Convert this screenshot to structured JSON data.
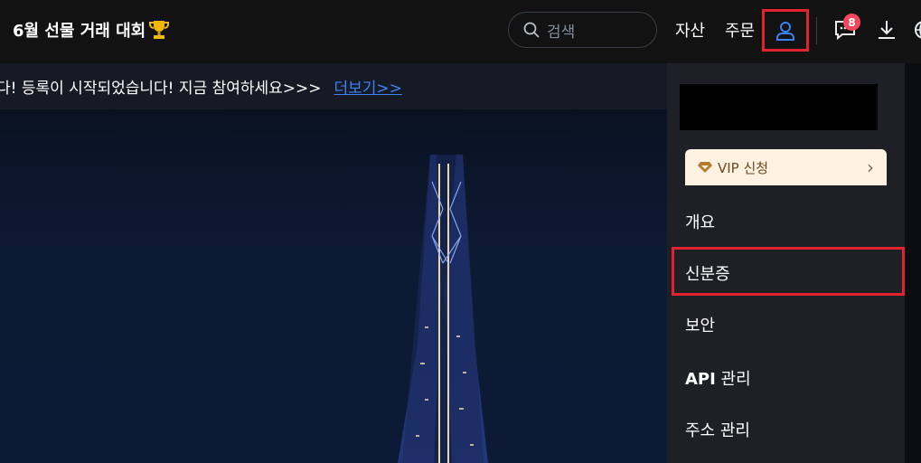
{
  "header": {
    "promo_title": "6월 선물 거래 대회",
    "search_placeholder": "검색",
    "nav_assets": "자산",
    "nav_orders": "주문",
    "message_count": "8",
    "icons": [
      "trophy-icon",
      "search-icon",
      "user-icon",
      "message-icon",
      "download-icon",
      "globe-icon"
    ]
  },
  "announcement": {
    "text": "다! 등록이 시작되었습니다! 지금 참여하세요>>>",
    "link": "더보기>>"
  },
  "user_menu": {
    "vip_label": "VIP 신청",
    "items": [
      {
        "label": "개요"
      },
      {
        "label": "신분증"
      },
      {
        "label": "보안"
      },
      {
        "label_bold": "API",
        "label_rest": " 관리"
      },
      {
        "label": "주소 관리"
      }
    ]
  },
  "colors": {
    "highlight": "#e0232e",
    "accent_blue": "#3b82f6",
    "badge": "#f6465d",
    "vip_bg": "#fdf1e2"
  }
}
